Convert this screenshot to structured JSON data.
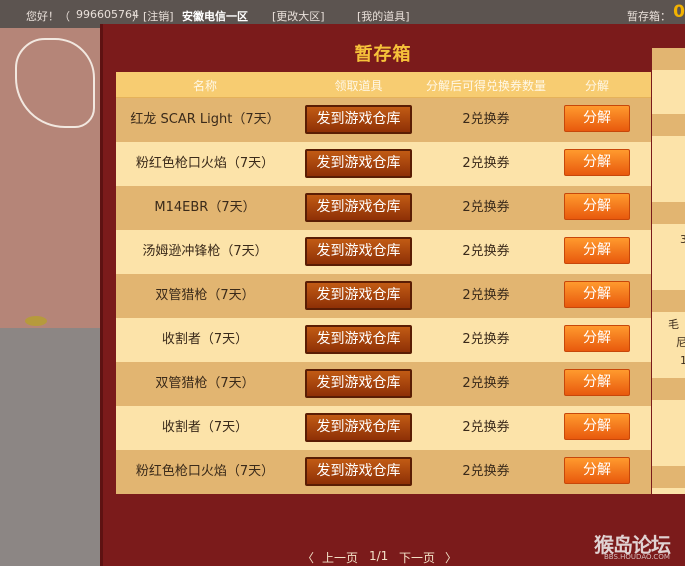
{
  "topbar": {
    "greeting": "您好！（",
    "user_id": "996605764",
    "close_paren": "）",
    "logout": "[注销]",
    "server": "安徽电信一区",
    "change_server": "[更改大区]",
    "my_items": "[我的道具]",
    "storage_label": "暂存箱：",
    "storage_count": "0"
  },
  "modal": {
    "title": "暂存箱"
  },
  "table": {
    "headers": [
      "名称",
      "领取道具",
      "分解后可得兑换券数量",
      "分解"
    ],
    "rows": [
      {
        "name": "红龙 SCAR Light（7天）",
        "send_label": "发到游戏仓库",
        "value": "2兑换券",
        "split_label": "分解"
      },
      {
        "name": "粉红色枪口火焰（7天）",
        "send_label": "发到游戏仓库",
        "value": "2兑换券",
        "split_label": "分解"
      },
      {
        "name": "M14EBR（7天）",
        "send_label": "发到游戏仓库",
        "value": "2兑换券",
        "split_label": "分解"
      },
      {
        "name": "汤姆逊冲锋枪（7天）",
        "send_label": "发到游戏仓库",
        "value": "2兑换券",
        "split_label": "分解"
      },
      {
        "name": "双管猎枪（7天）",
        "send_label": "发到游戏仓库",
        "value": "2兑换券",
        "split_label": "分解"
      },
      {
        "name": "收割者（7天）",
        "send_label": "发到游戏仓库",
        "value": "2兑换券",
        "split_label": "分解"
      },
      {
        "name": "双管猎枪（7天）",
        "send_label": "发到游戏仓库",
        "value": "2兑换券",
        "split_label": "分解"
      },
      {
        "name": "收割者（7天）",
        "send_label": "发到游戏仓库",
        "value": "2兑换券",
        "split_label": "分解"
      },
      {
        "name": "粉红色枪口火焰（7天）",
        "send_label": "发到游戏仓库",
        "value": "2兑换券",
        "split_label": "分解"
      }
    ]
  },
  "rightpanel": {
    "text1": "毛",
    "text2": "尼",
    "text3": "1",
    "text4": "3"
  },
  "pager": {
    "prev_arrow": "〈",
    "prev": "上一页",
    "page": "1/1",
    "next": "下一页",
    "next_arrow": "〉"
  },
  "watermark": {
    "text": "猴岛论坛",
    "url": "BBS.HOUDAO.COM"
  },
  "colors": {
    "modal_bg": "#7b1b1b",
    "title": "#f6c23a",
    "row_odd": "#e2b571",
    "row_even": "#fce3a9",
    "split_button": "#f27a1e",
    "send_button": "#a8420b"
  }
}
